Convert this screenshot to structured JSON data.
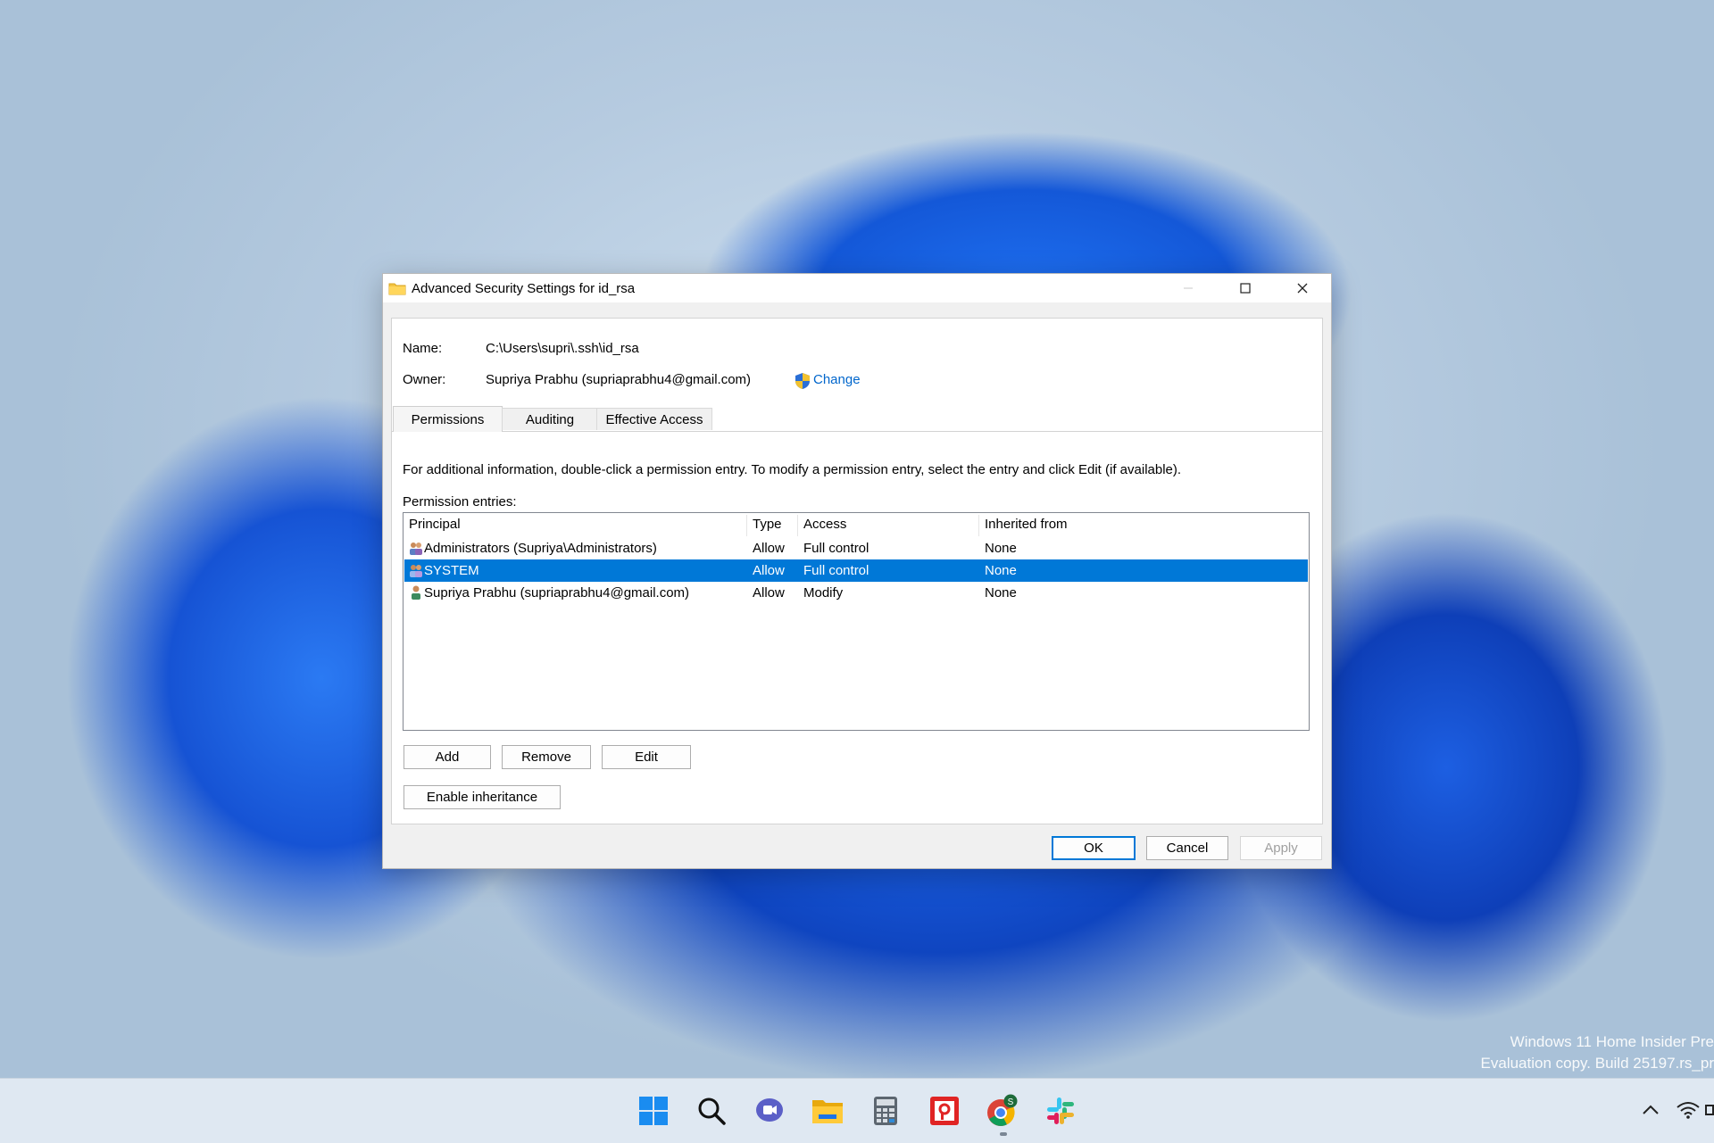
{
  "window": {
    "title": "Advanced Security Settings for id_rsa",
    "name_label": "Name:",
    "name_value": "C:\\Users\\supri\\.ssh\\id_rsa",
    "owner_label": "Owner:",
    "owner_value": "Supriya Prabhu (supriaprabhu4@gmail.com)",
    "change_link": "Change",
    "tabs": [
      {
        "label": "Permissions",
        "active": true
      },
      {
        "label": "Auditing",
        "active": false
      },
      {
        "label": "Effective Access",
        "active": false
      }
    ],
    "info_text": "For additional information, double-click a permission entry. To modify a permission entry, select the entry and click Edit (if available).",
    "entries_label": "Permission entries:",
    "columns": [
      "Principal",
      "Type",
      "Access",
      "Inherited from"
    ],
    "rows": [
      {
        "principal": "Administrators (Supriya\\Administrators)",
        "type": "Allow",
        "access": "Full control",
        "inherited": "None",
        "icon": "group-icon",
        "selected": false
      },
      {
        "principal": "SYSTEM",
        "type": "Allow",
        "access": "Full control",
        "inherited": "None",
        "icon": "group-icon",
        "selected": true
      },
      {
        "principal": "Supriya Prabhu (supriaprabhu4@gmail.com)",
        "type": "Allow",
        "access": "Modify",
        "inherited": "None",
        "icon": "user-icon",
        "selected": false
      }
    ],
    "buttons": {
      "add": "Add",
      "remove": "Remove",
      "edit": "Edit",
      "enable_inheritance": "Enable inheritance",
      "ok": "OK",
      "cancel": "Cancel",
      "apply": "Apply"
    }
  },
  "watermark": {
    "line1": "Windows 11 Home Insider Pre",
    "line2": "Evaluation copy. Build 25197.rs_pr"
  },
  "taskbar": {
    "icons": [
      "windows-start-icon",
      "search-icon",
      "chat-icon",
      "file-explorer-icon",
      "calculator-icon",
      "screen-recorder-icon",
      "chrome-icon",
      "slack-icon"
    ],
    "chrome_profile_badge": "S"
  },
  "colors": {
    "selection": "#0078d7",
    "link": "#0066cc",
    "accent": "#0078d7"
  }
}
